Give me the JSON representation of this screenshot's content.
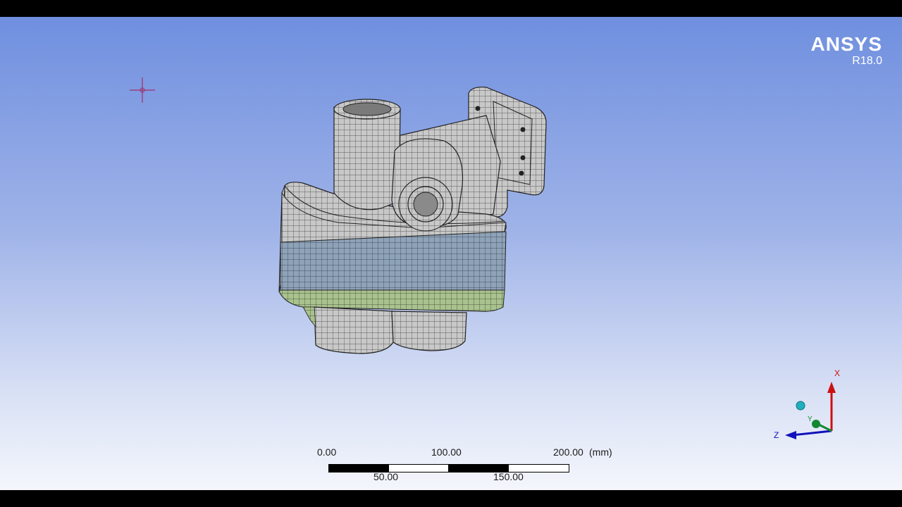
{
  "branding": {
    "name": "ANSYS",
    "version": "R18.0"
  },
  "scale_bar": {
    "unit": "(mm)",
    "top_labels": [
      "0.00",
      "100.00",
      "200.00"
    ],
    "bottom_labels": [
      "50.00",
      "150.00"
    ]
  },
  "triad": {
    "x": "X",
    "y": "Y",
    "z": "Z"
  },
  "colors": {
    "background_top": "#6f8fdf",
    "background_bottom": "#f4f6fc",
    "mesh_body": "#c8c8c8",
    "mesh_selected_blue": "#8ea2b8",
    "mesh_selected_green": "#a9c28e",
    "axis_x": "#cc1111",
    "axis_y": "#118833",
    "axis_z": "#1111bb"
  },
  "icons": [
    "cursor-crosshair-icon",
    "axis-triad-icon"
  ]
}
